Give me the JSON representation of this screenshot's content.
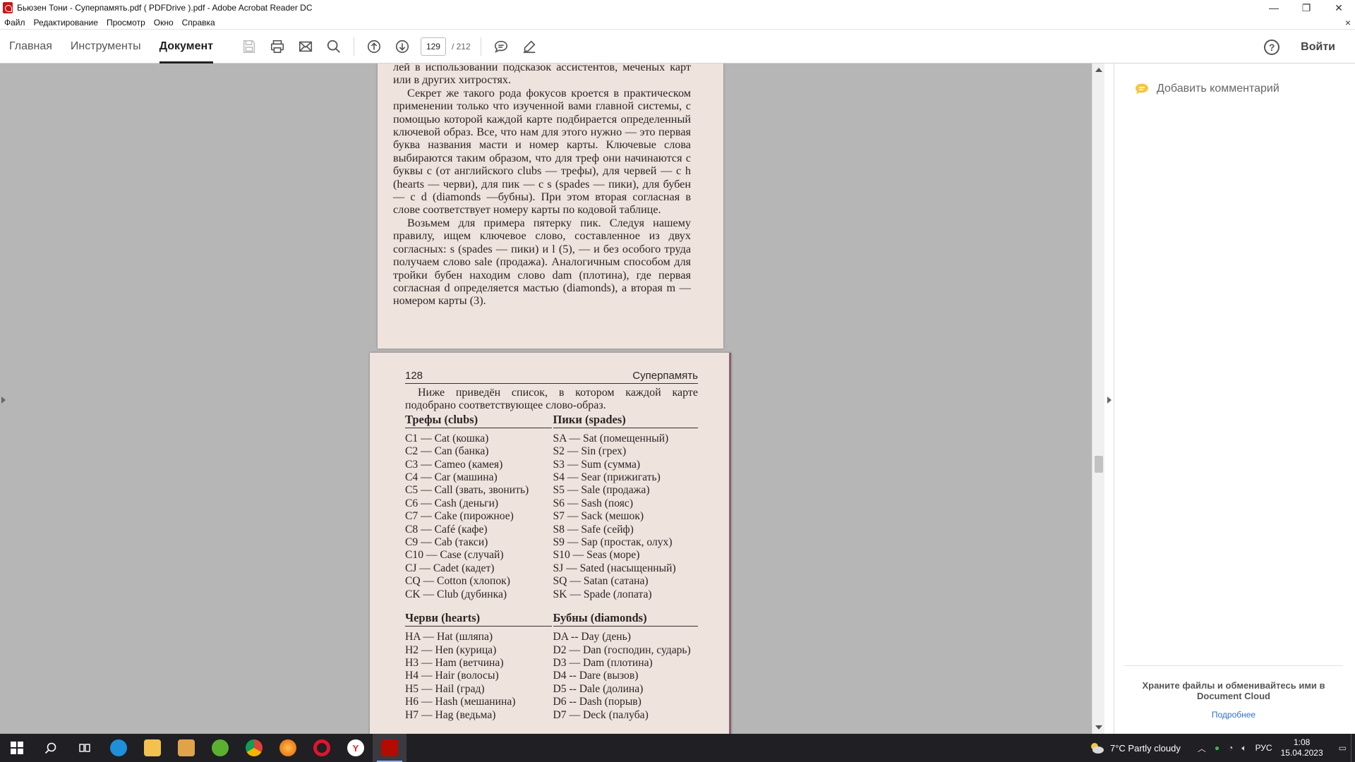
{
  "window": {
    "title": "Бьюзен Тони - Суперпамять.pdf ( PDFDrive ).pdf - Adobe Acrobat Reader DC",
    "minimize": "—",
    "restore": "❐",
    "close": "✕"
  },
  "menu": {
    "items": [
      {
        "label": "Файл"
      },
      {
        "label": "Редактирование"
      },
      {
        "label": "Просмотр"
      },
      {
        "label": "Окно"
      },
      {
        "label": "Справка"
      }
    ],
    "close_doc": "×"
  },
  "toolbar": {
    "tabs": [
      {
        "label": "Главная",
        "active": false
      },
      {
        "label": "Инструменты",
        "active": false
      },
      {
        "label": "Документ",
        "active": true
      }
    ],
    "page_current": "129",
    "page_total": "/  212",
    "signin": "Войти",
    "help": "?"
  },
  "page1": {
    "paragraphs": [
      "лей в использовании подсказок ассистентов, меченых карт или в других хитростях.",
      "Секрет же такого рода фокусов кроется в практическом применении только что изученной вами главной системы, с помощью которой каждой карте подбирается определенный ключевой образ. Все, что нам для этого нужно — это первая буква названия масти и номер карты. Ключевые слова выбираются таким образом, что для треф они начинаются с буквы c (от английского clubs — трефы), для червей — с h (hearts — черви), для пик — с s (spades — пики), для бубен — с d (diamonds —бубны). При этом вторая согласная в слове соответствует номеру карты по кодовой таблице.",
      "Возьмем для примера пятерку пик. Следуя нашему правилу, ищем ключевое слово, составленное из двух согласных: s (spades — пики) и l (5), — и без особого труда получаем слово sale (продажа). Аналогичным способом для тройки бубен находим слово dam (плотина), где первая согласная d определяется мастью (diamonds), а вторая m — номером карты (3)."
    ]
  },
  "page2": {
    "page_number": "128",
    "running_title": "Суперпамять",
    "intro": "Ниже приведён список, в котором каждой карте подобрано соответствующее слово-образ.",
    "clubs": {
      "heading": "Трефы (clubs)",
      "rows": [
        "C1 — Cat (кошка)",
        "C2 — Can (банка)",
        "C3 — Cameo (камея)",
        "C4 — Car (машина)",
        "C5 — Call (звать, звонить)",
        "C6 — Cash (деньги)",
        "C7 — Cake (пирожное)",
        "C8 — Café (кафе)",
        "C9 — Cab (такси)",
        "C10 — Case (случай)",
        "CJ — Cadet (кадет)",
        "CQ — Cotton (хлопок)",
        "CK — Club (дубинка)"
      ]
    },
    "spades": {
      "heading": "Пики (spades)",
      "rows": [
        "SA — Sat (помещенный)",
        "S2 — Sin (грех)",
        "S3 — Sum (сумма)",
        "S4 — Sear (прижигать)",
        "S5 — Sale (продажа)",
        "S6 — Sash (пояс)",
        "S7 — Sack (мешок)",
        "S8 — Safe (сейф)",
        "S9 — Sap (простак, олух)",
        "S10 — Seas (море)",
        "SJ — Sated (насыщенный)",
        "SQ — Satan (сатана)",
        "SK — Spade (лопата)"
      ]
    },
    "hearts": {
      "heading": "Черви (hearts)",
      "rows": [
        "HA — Hat (шляпа)",
        "H2 — Hen (курица)",
        "H3 — Ham (ветчина)",
        "H4 — Hair (волосы)",
        "H5 — Hail (град)",
        "H6 — Hash (мешанина)",
        "H7 — Hag (ведьма)"
      ]
    },
    "diamonds": {
      "heading": "Бубны (diamonds)",
      "rows": [
        "DA -- Day (день)",
        "D2 — Dan (господин, сударь)",
        "D3 — Dam (плотина)",
        "D4 -- Dare (вызов)",
        "D5 -- Dale (долина)",
        "D6 -- Dash (порыв)",
        "D7 — Deck (палуба)"
      ]
    }
  },
  "right_pane": {
    "add_comment": "Добавить комментарий",
    "cloud_text": "Храните файлы и обменивайтесь ими в Document Cloud",
    "cloud_link": "Подробнее"
  },
  "taskbar": {
    "weather": "7°C  Partly cloudy",
    "lang": "РУС",
    "time": "1:08",
    "date": "15.04.2023"
  },
  "colors": {
    "page_bg": "#efe3dd",
    "doc_bg": "#b6b6b6",
    "taskbar": "#1f1f24",
    "link": "#2d6fd6",
    "acrobat_red": "#c4161c"
  }
}
